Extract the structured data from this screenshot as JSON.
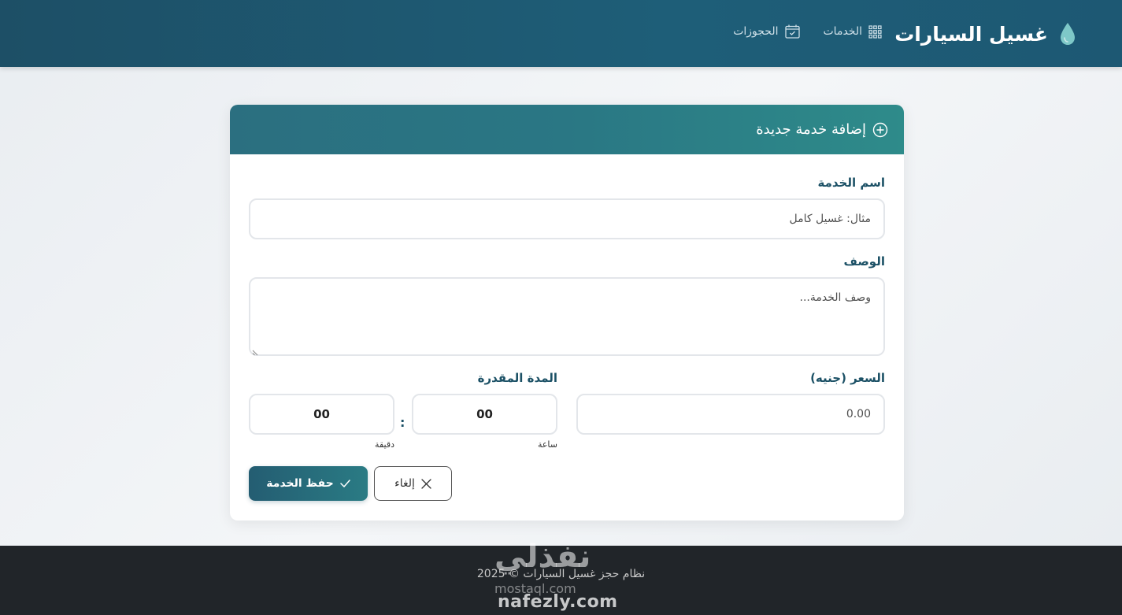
{
  "navbar": {
    "brand": "غسيل السيارات",
    "links": [
      {
        "label": "الخدمات",
        "icon": "grid-icon"
      },
      {
        "label": "الحجوزات",
        "icon": "calendar-check-icon"
      }
    ]
  },
  "form": {
    "title": "إضافة خدمة جديدة",
    "name_label": "اسم الخدمة",
    "name_placeholder": "مثال: غسيل كامل",
    "description_label": "الوصف",
    "description_placeholder": "وصف الخدمة...",
    "price_label": "السعر (جنيه)",
    "price_placeholder": "0.00",
    "duration_label": "المدة المقدرة",
    "hours_value": "00",
    "minutes_value": "00",
    "separator": ":",
    "hours_caption": "ساعة",
    "minutes_caption": "دقيقة",
    "save_label": "حفظ الخدمة",
    "cancel_label": "إلغاء"
  },
  "footer": {
    "text": "نظام حجز غسيل السيارات © 2025"
  },
  "watermark": {
    "arabic": "نفذلي",
    "subtitle": "mostaql.com",
    "site": "nafezly.com"
  },
  "colors": {
    "navbar": "#1d5873",
    "accent": "#1c5166",
    "header_gradient_end": "#2e8b8a",
    "footer": "#212529"
  }
}
